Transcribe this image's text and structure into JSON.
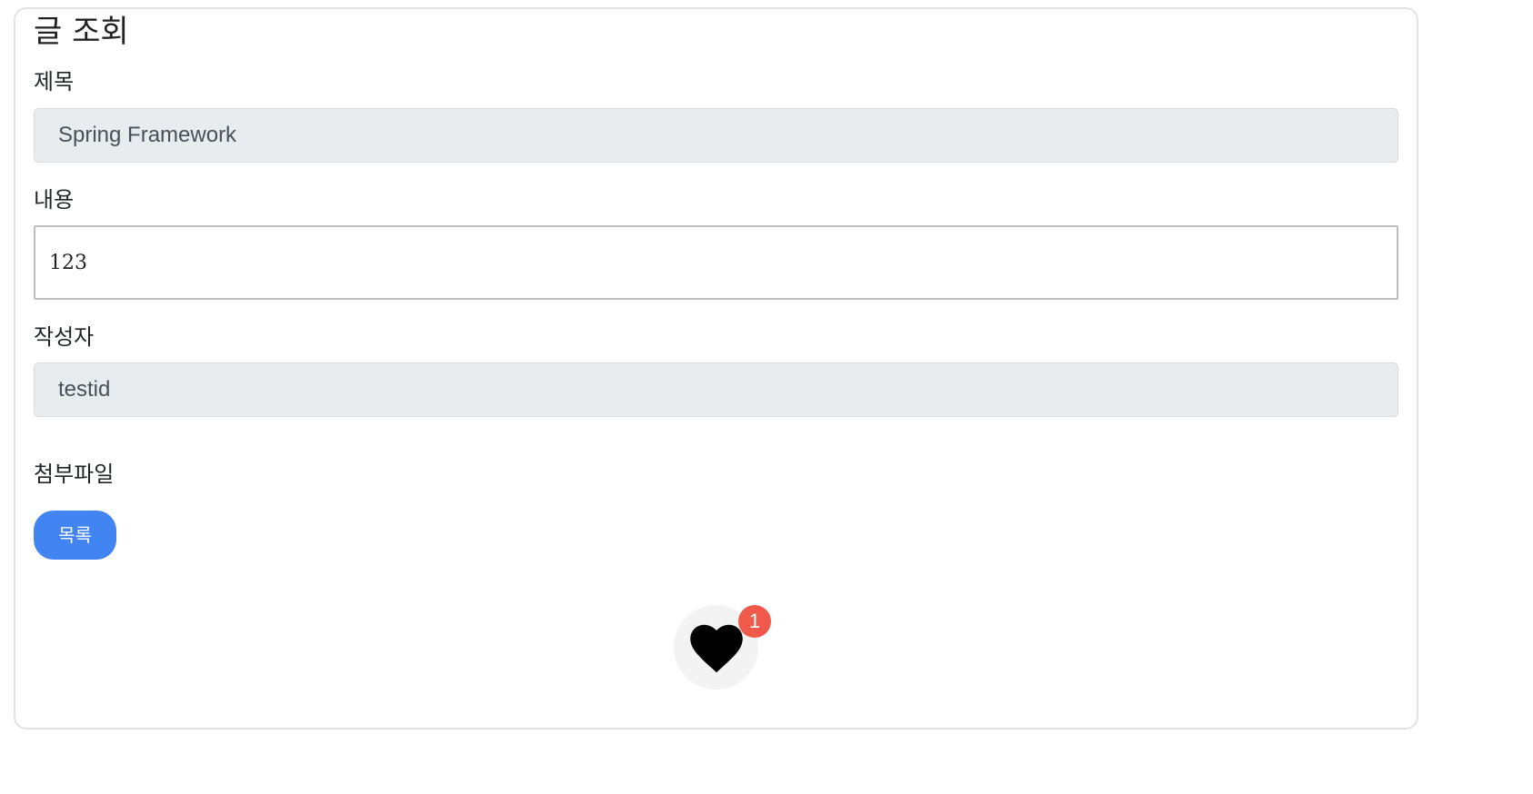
{
  "page": {
    "title": "글 조회"
  },
  "form": {
    "subject_label": "제목",
    "subject_value": "Spring Framework",
    "content_label": "내용",
    "content_value": "123",
    "writer_label": "작성자",
    "writer_value": "testid",
    "attachment_label": "첨부파일"
  },
  "actions": {
    "list_button_label": "목록"
  },
  "like": {
    "icon": "heart-icon",
    "count": "1"
  },
  "colors": {
    "primary": "#4284f1",
    "badge": "#f15a4a",
    "readonly_bg": "#e9ecef"
  }
}
